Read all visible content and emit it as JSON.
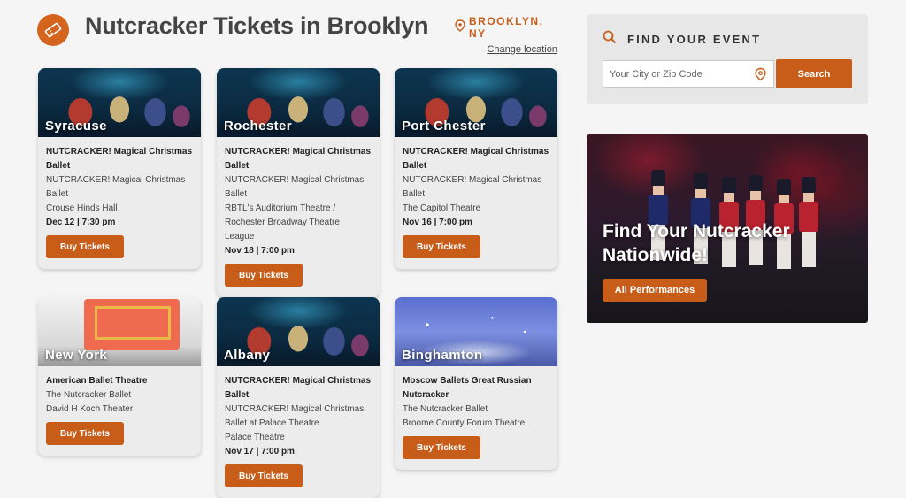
{
  "header": {
    "title": "Nutcracker Tickets in Brooklyn",
    "location": "BROOKLYN, NY",
    "change_location": "Change location"
  },
  "cards": [
    {
      "city": "Syracuse",
      "title": "NUTCRACKER! Magical Christmas Ballet",
      "lines": [
        "NUTCRACKER! Magical Christmas Ballet",
        "Crouse Hinds Hall"
      ],
      "date": "Dec 12 | 7:30 pm",
      "button": "Buy Tickets"
    },
    {
      "city": "Rochester",
      "title": "NUTCRACKER! Magical Christmas Ballet",
      "lines": [
        "NUTCRACKER! Magical Christmas Ballet",
        "RBTL's Auditorium Theatre / Rochester Broadway Theatre League"
      ],
      "date": "Nov 18 | 7:00 pm",
      "button": "Buy Tickets"
    },
    {
      "city": "Port Chester",
      "title": "NUTCRACKER! Magical Christmas Ballet",
      "lines": [
        "NUTCRACKER! Magical Christmas Ballet",
        "The Capitol Theatre"
      ],
      "date": "Nov 16 | 7:00 pm",
      "button": "Buy Tickets"
    },
    {
      "city": "New York",
      "title": "American Ballet Theatre",
      "lines": [
        "The Nutcracker Ballet",
        "David H Koch Theater"
      ],
      "date": "",
      "button": "Buy Tickets"
    },
    {
      "city": "Albany",
      "title": "NUTCRACKER! Magical Christmas Ballet",
      "lines": [
        "NUTCRACKER! Magical Christmas Ballet at Palace Theatre",
        "Palace Theatre"
      ],
      "date": "Nov 17 | 7:00 pm",
      "button": "Buy Tickets"
    },
    {
      "city": "Binghamton",
      "title": "Moscow Ballets Great Russian Nutcracker",
      "lines": [
        "The Nutcracker Ballet",
        "Broome County Forum Theatre"
      ],
      "date": "",
      "button": "Buy Tickets"
    }
  ],
  "find_event": {
    "title": "FIND YOUR EVENT",
    "placeholder": "Your City or Zip Code",
    "value": "",
    "button": "Search"
  },
  "promo": {
    "heading": "Find Your Nutcracker Nationwide!",
    "button": "All Performances"
  },
  "colors": {
    "accent": "#c85d1a",
    "panel": "#e7e7e7",
    "background": "#f5f5f5"
  }
}
